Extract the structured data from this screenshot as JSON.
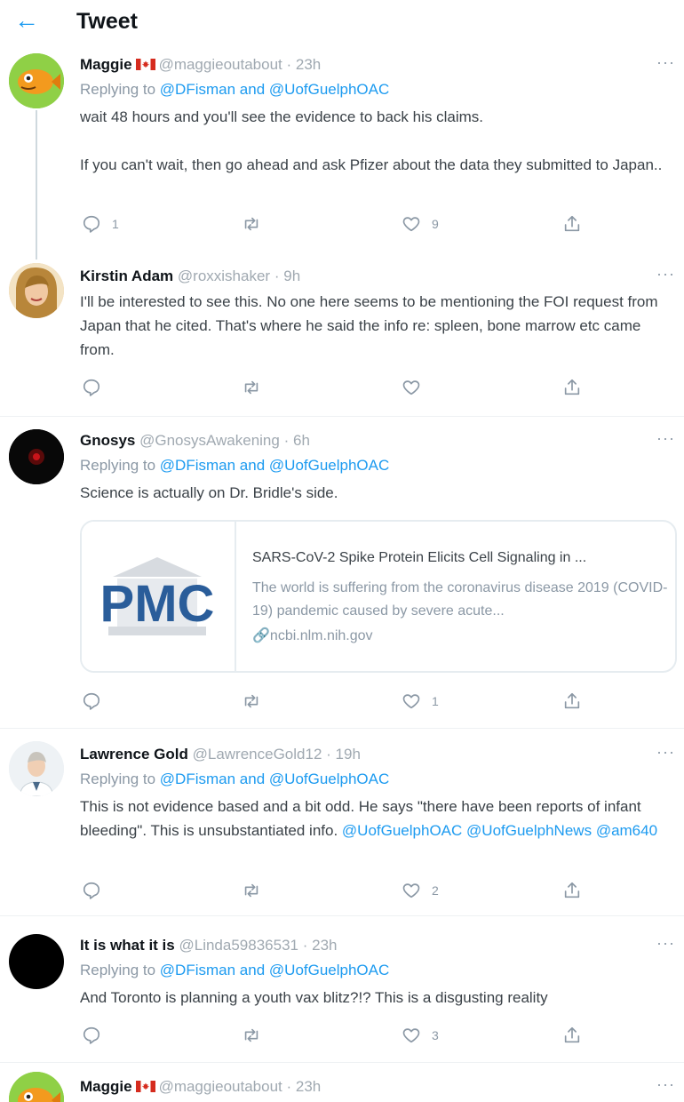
{
  "header": {
    "back_icon": "arrow-left-icon",
    "title": "Tweet"
  },
  "colors": {
    "accent": "#1d9bf0",
    "muted": "#8b98a5",
    "text": "#0f1419"
  },
  "tweets": [
    {
      "name": "Maggie",
      "flag": "canada-flag",
      "handle": "@maggieoutabout",
      "time": "23h",
      "reply_prefix": "Replying to",
      "reply_to_1": "@DFisman",
      "reply_and": "and",
      "reply_to_2": "@UofGuelphOAC",
      "text_1": "wait 48 hours and you'll see the evidence to back his claims.",
      "text_2": "If you can't wait, then go ahead and ask Pfizer about the data they submitted to Japan..",
      "replies": "1",
      "likes": "9"
    },
    {
      "name": "Kirstin Adam",
      "handle": "@roxxishaker",
      "time": "9h",
      "text_1": "I'll be interested to see this. No one here seems to be mentioning the FOI request from Japan that he cited. That's where he said the info re: spleen, bone marrow etc came from."
    },
    {
      "name": "Gnosys",
      "handle": "@GnosysAwakening",
      "time": "6h",
      "reply_prefix": "Replying to",
      "reply_to_1": "@DFisman",
      "reply_and": "and",
      "reply_to_2": "@UofGuelphOAC",
      "text_1": "Science is actually on Dr. Bridle's side.",
      "card": {
        "logo_text": "PMC",
        "title": "SARS-CoV-2 Spike Protein Elicits Cell Signaling in ...",
        "description": "The world is suffering from the coronavirus disease 2019 (COVID-19) pandemic caused by severe acute...",
        "domain": "ncbi.nlm.nih.gov"
      },
      "likes": "1"
    },
    {
      "name": "Lawrence Gold",
      "handle": "@LawrenceGold12",
      "time": "19h",
      "reply_prefix": "Replying to",
      "reply_to_1": "@DFisman",
      "reply_and": "and",
      "reply_to_2": "@UofGuelphOAC",
      "text_1": "This is not evidence based and a bit odd. He says \"there have been reports of infant bleeding\". This is unsubstantiated info.",
      "mention_1": "@UofGuelphOAC",
      "mention_2": "@UofGuelphNews",
      "mention_3": "@am640",
      "likes": "2"
    },
    {
      "name": "It is what it is",
      "handle": "@Linda59836531",
      "time": "23h",
      "reply_prefix": "Replying to",
      "reply_to_1": "@DFisman",
      "reply_and": "and",
      "reply_to_2": "@UofGuelphOAC",
      "text_1": "And Toronto is planning a youth vax blitz?!?  This is a disgusting reality",
      "likes": "3"
    },
    {
      "name": "Maggie",
      "flag": "canada-flag",
      "handle": "@maggieoutabout",
      "time": "23h"
    }
  ],
  "icons": {
    "more": "more-icon",
    "reply": "reply-icon",
    "retweet": "retweet-icon",
    "like": "like-icon",
    "share": "share-icon",
    "link": "link-icon"
  },
  "separators": {
    "dot": "·",
    "more_glyph": "···"
  }
}
